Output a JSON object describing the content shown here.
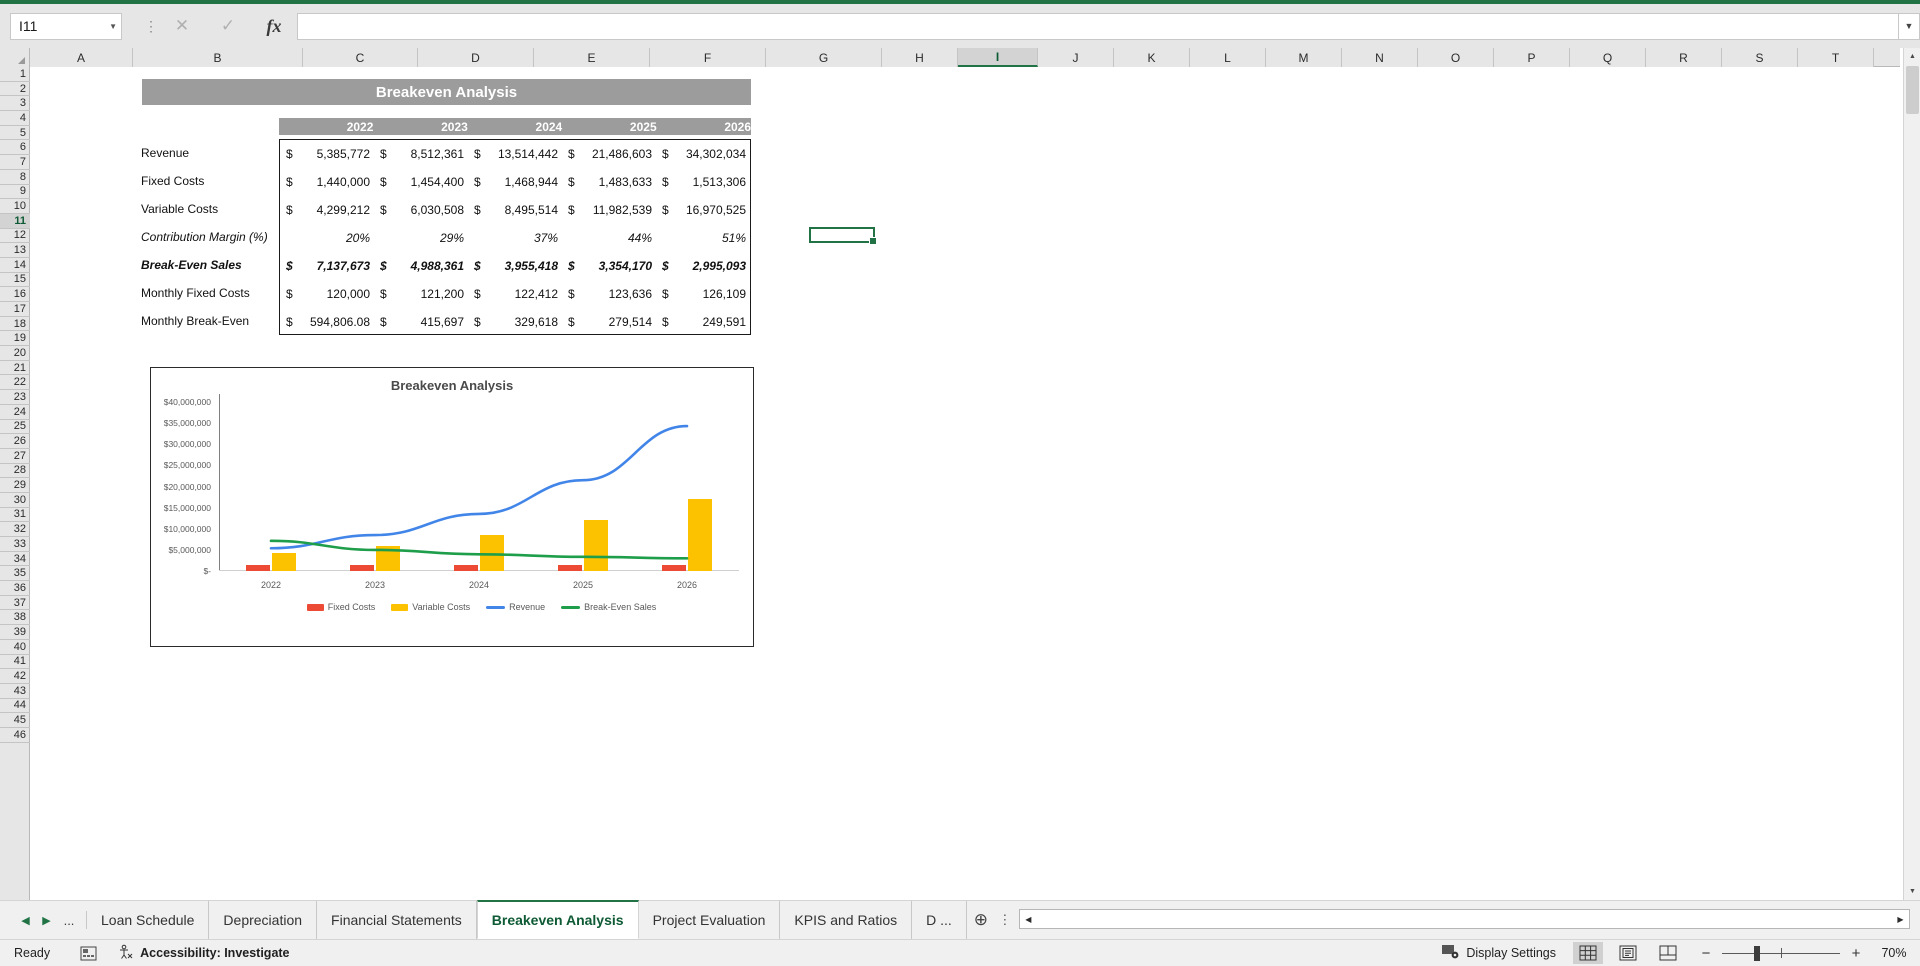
{
  "formula_bar": {
    "name_box_value": "I11",
    "formula_value": "",
    "cancel_icon": "close-icon",
    "confirm_icon": "check-icon",
    "function_icon": "fx-icon",
    "expand_icon": "chevron-down-icon"
  },
  "columns": [
    "A",
    "B",
    "C",
    "D",
    "E",
    "F",
    "G",
    "H",
    "I",
    "J",
    "K",
    "L",
    "M",
    "N",
    "O",
    "P",
    "Q",
    "R",
    "S",
    "T"
  ],
  "selected_column": "I",
  "selected_row": "11",
  "report": {
    "title": "Breakeven Analysis",
    "years": [
      "2022",
      "2023",
      "2024",
      "2025",
      "2026"
    ],
    "currency_symbol": "$",
    "rows": [
      {
        "label": "Revenue",
        "style": "normal",
        "currency": true,
        "values": [
          "5,385,772",
          "8,512,361",
          "13,514,442",
          "21,486,603",
          "34,302,034"
        ]
      },
      {
        "label": "Fixed Costs",
        "style": "normal",
        "currency": true,
        "values": [
          "1,440,000",
          "1,454,400",
          "1,468,944",
          "1,483,633",
          "1,513,306"
        ]
      },
      {
        "label": "Variable Costs",
        "style": "normal",
        "currency": true,
        "values": [
          "4,299,212",
          "6,030,508",
          "8,495,514",
          "11,982,539",
          "16,970,525"
        ]
      },
      {
        "label": "Contribution Margin (%)",
        "style": "italic",
        "currency": false,
        "values": [
          "20%",
          "29%",
          "37%",
          "44%",
          "51%"
        ]
      },
      {
        "label": "Break-Even Sales",
        "style": "bolditalic",
        "currency": true,
        "values": [
          "7,137,673",
          "4,988,361",
          "3,955,418",
          "3,354,170",
          "2,995,093"
        ]
      },
      {
        "label": "Monthly Fixed Costs",
        "style": "normal",
        "currency": true,
        "values": [
          "120,000",
          "121,200",
          "122,412",
          "123,636",
          "126,109"
        ]
      },
      {
        "label": "Monthly Break-Even",
        "style": "normal",
        "currency": true,
        "values": [
          "594,806.08",
          "415,697",
          "329,618",
          "279,514",
          "249,591"
        ]
      }
    ]
  },
  "chart_data": {
    "type": "bar",
    "title": "Breakeven Analysis",
    "xlabel": "",
    "ylabel": "",
    "ylim": [
      0,
      40000000
    ],
    "grid": false,
    "legend_position": "bottom",
    "categories": [
      "2022",
      "2023",
      "2024",
      "2025",
      "2026"
    ],
    "ytick_labels": [
      "$40,000,000",
      "$35,000,000",
      "$30,000,000",
      "$25,000,000",
      "$20,000,000",
      "$15,000,000",
      "$10,000,000",
      "$5,000,000",
      "$-"
    ],
    "ytick_values": [
      40000000,
      35000000,
      30000000,
      25000000,
      20000000,
      15000000,
      10000000,
      5000000,
      0
    ],
    "series": [
      {
        "name": "Fixed Costs",
        "type": "bar",
        "color": "#ED4A36",
        "values": [
          1440000,
          1454400,
          1468944,
          1483633,
          1513306
        ]
      },
      {
        "name": "Variable Costs",
        "type": "bar",
        "color": "#FCC200",
        "values": [
          4299212,
          6030508,
          8495514,
          11982539,
          16970525
        ]
      },
      {
        "name": "Revenue",
        "type": "line",
        "color": "#4285E8",
        "values": [
          5385772,
          8512361,
          13514442,
          21486603,
          34302034
        ]
      },
      {
        "name": "Break-Even Sales",
        "type": "line",
        "color": "#1E9E4A",
        "values": [
          7137673,
          4988361,
          3955418,
          3354170,
          2995093
        ]
      }
    ]
  },
  "tabbar": {
    "prev_icon": "triangle-left-icon",
    "next_icon": "triangle-right-icon",
    "overflow_label": "...",
    "tabs": [
      {
        "label": "Loan Schedule",
        "active": false
      },
      {
        "label": "Depreciation",
        "active": false
      },
      {
        "label": "Financial Statements",
        "active": false
      },
      {
        "label": "Breakeven Analysis",
        "active": true
      },
      {
        "label": "Project Evaluation",
        "active": false
      },
      {
        "label": "KPIS and Ratios",
        "active": false
      },
      {
        "label": "D ...",
        "active": false
      }
    ],
    "add_sheet_icon": "plus-circle-icon",
    "kebab_icon": "more-options-icon",
    "hscroll_left_icon": "triangle-left-icon",
    "hscroll_right_icon": "triangle-right-icon"
  },
  "statusbar": {
    "ready_label": "Ready",
    "macro_icon": "record-macro-icon",
    "accessibility_icon": "accessibility-icon",
    "accessibility_label": "Accessibility: Investigate",
    "display_settings_icon": "display-settings-icon",
    "display_settings_label": "Display Settings",
    "view_normal_icon": "normal-view-icon",
    "view_pagelayout_icon": "page-layout-view-icon",
    "view_pagebreak_icon": "page-break-view-icon",
    "zoom_out_icon": "minus-icon",
    "zoom_in_icon": "plus-icon",
    "zoom_level": "70%"
  },
  "theme": {
    "accent_green": "#217346",
    "banner_gray": "#9C9C9C",
    "fixed_costs": "#ED4A36",
    "variable_costs": "#FCC200",
    "revenue": "#4285E8",
    "breakeven": "#1E9E4A"
  }
}
